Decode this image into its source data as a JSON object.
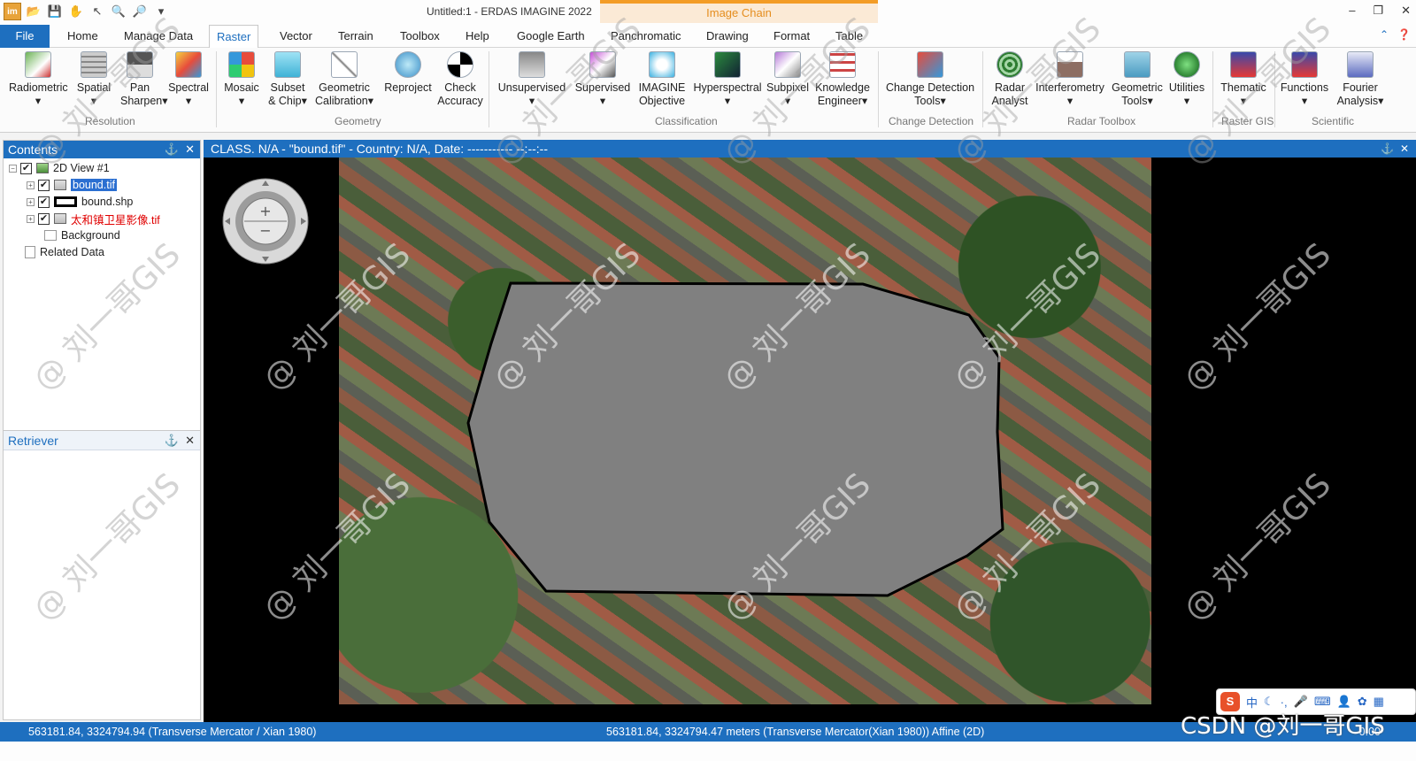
{
  "window": {
    "title": "Untitled:1 - ERDAS IMAGINE 2022",
    "context_tab": "Image Chain",
    "controls": [
      "–",
      "❐",
      "✕"
    ]
  },
  "qat": {
    "app_label": "im"
  },
  "tabs": {
    "file": "File",
    "items": [
      "Home",
      "Manage Data",
      "Raster",
      "Vector",
      "Terrain",
      "Toolbox",
      "Help",
      "Google Earth",
      "Panchromatic",
      "Drawing",
      "Format",
      "Table"
    ],
    "active": "Raster"
  },
  "ribbon": {
    "buttons": [
      {
        "label": "Radiometric",
        "sub": "▾"
      },
      {
        "label": "Spatial",
        "sub": "▾"
      },
      {
        "label": "Pan",
        "sub": "Sharpen▾"
      },
      {
        "label": "Spectral",
        "sub": "▾"
      },
      {
        "label": "Mosaic",
        "sub": "▾"
      },
      {
        "label": "Subset",
        "sub": "& Chip▾"
      },
      {
        "label": "Geometric",
        "sub": "Calibration▾"
      },
      {
        "label": "Reproject",
        "sub": ""
      },
      {
        "label": "Check",
        "sub": "Accuracy"
      },
      {
        "label": "Unsupervised",
        "sub": "▾"
      },
      {
        "label": "Supervised",
        "sub": "▾"
      },
      {
        "label": "IMAGINE",
        "sub": "Objective"
      },
      {
        "label": "Hyperspectral",
        "sub": "▾"
      },
      {
        "label": "Subpixel",
        "sub": "▾"
      },
      {
        "label": "Knowledge",
        "sub": "Engineer▾"
      },
      {
        "label": "Change Detection",
        "sub": "Tools▾"
      },
      {
        "label": "Radar",
        "sub": "Analyst"
      },
      {
        "label": "Interferometry",
        "sub": "▾"
      },
      {
        "label": "Geometric",
        "sub": "Tools▾"
      },
      {
        "label": "Utilities",
        "sub": "▾"
      },
      {
        "label": "Thematic",
        "sub": "▾"
      },
      {
        "label": "Functions",
        "sub": "▾"
      },
      {
        "label": "Fourier",
        "sub": "Analysis▾"
      }
    ],
    "groups": [
      "Resolution",
      "Geometry",
      "Classification",
      "Change Detection",
      "Radar Toolbox",
      "Raster GIS",
      "Scientific"
    ]
  },
  "contents": {
    "title": "Contents",
    "pin": "⚓",
    "close": "✕",
    "view": "2D View #1",
    "layers": [
      {
        "name": "bound.tif",
        "checked": "✔"
      },
      {
        "name": "bound.shp",
        "checked": "✔"
      },
      {
        "name": "太和镇卫星影像.tif",
        "checked": "✔"
      }
    ],
    "background": "Background",
    "related": "Related Data"
  },
  "retriever": {
    "title": "Retriever"
  },
  "viewer": {
    "header": "CLASS. N/A - \"bound.tif\" - Country: N/A, Date: ----------- --:--:--"
  },
  "status": {
    "left": "563181.84, 3324794.94  (Transverse Mercator / Xian 1980)",
    "mid": "563181.84, 3324794.47 meters (Transverse Mercator(Xian 1980))  Affine (2D)",
    "right": "0.00"
  },
  "overlay": {
    "csdn": "CSDN @刘一哥GIS",
    "watermark": "@ 刘一哥GIS",
    "ime_logo": "S",
    "ime_text": "中"
  }
}
